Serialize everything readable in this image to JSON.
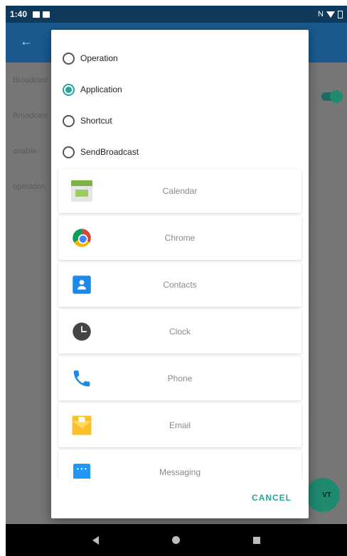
{
  "status_bar": {
    "time": "1:40",
    "right_text": "N"
  },
  "background": {
    "rows": [
      "Broadcast",
      "Broadcast",
      "enable",
      "operation"
    ]
  },
  "fab": {
    "label": "VT"
  },
  "dialog": {
    "radio_options": [
      {
        "label": "Operation",
        "checked": false
      },
      {
        "label": "Application",
        "checked": true
      },
      {
        "label": "Shortcut",
        "checked": false
      },
      {
        "label": "SendBroadcast",
        "checked": false
      }
    ],
    "apps": [
      {
        "label": "Calendar",
        "icon": "calendar-icon"
      },
      {
        "label": "Chrome",
        "icon": "chrome-icon"
      },
      {
        "label": "Contacts",
        "icon": "contacts-icon"
      },
      {
        "label": "Clock",
        "icon": "clock-icon"
      },
      {
        "label": "Phone",
        "icon": "phone-icon"
      },
      {
        "label": "Email",
        "icon": "email-icon"
      },
      {
        "label": "Messaging",
        "icon": "messaging-icon"
      }
    ],
    "cancel_label": "CANCEL"
  },
  "colors": {
    "accent": "#26a69a",
    "app_bar": "#1a5a8f",
    "status_bar": "#0f3a5c"
  }
}
